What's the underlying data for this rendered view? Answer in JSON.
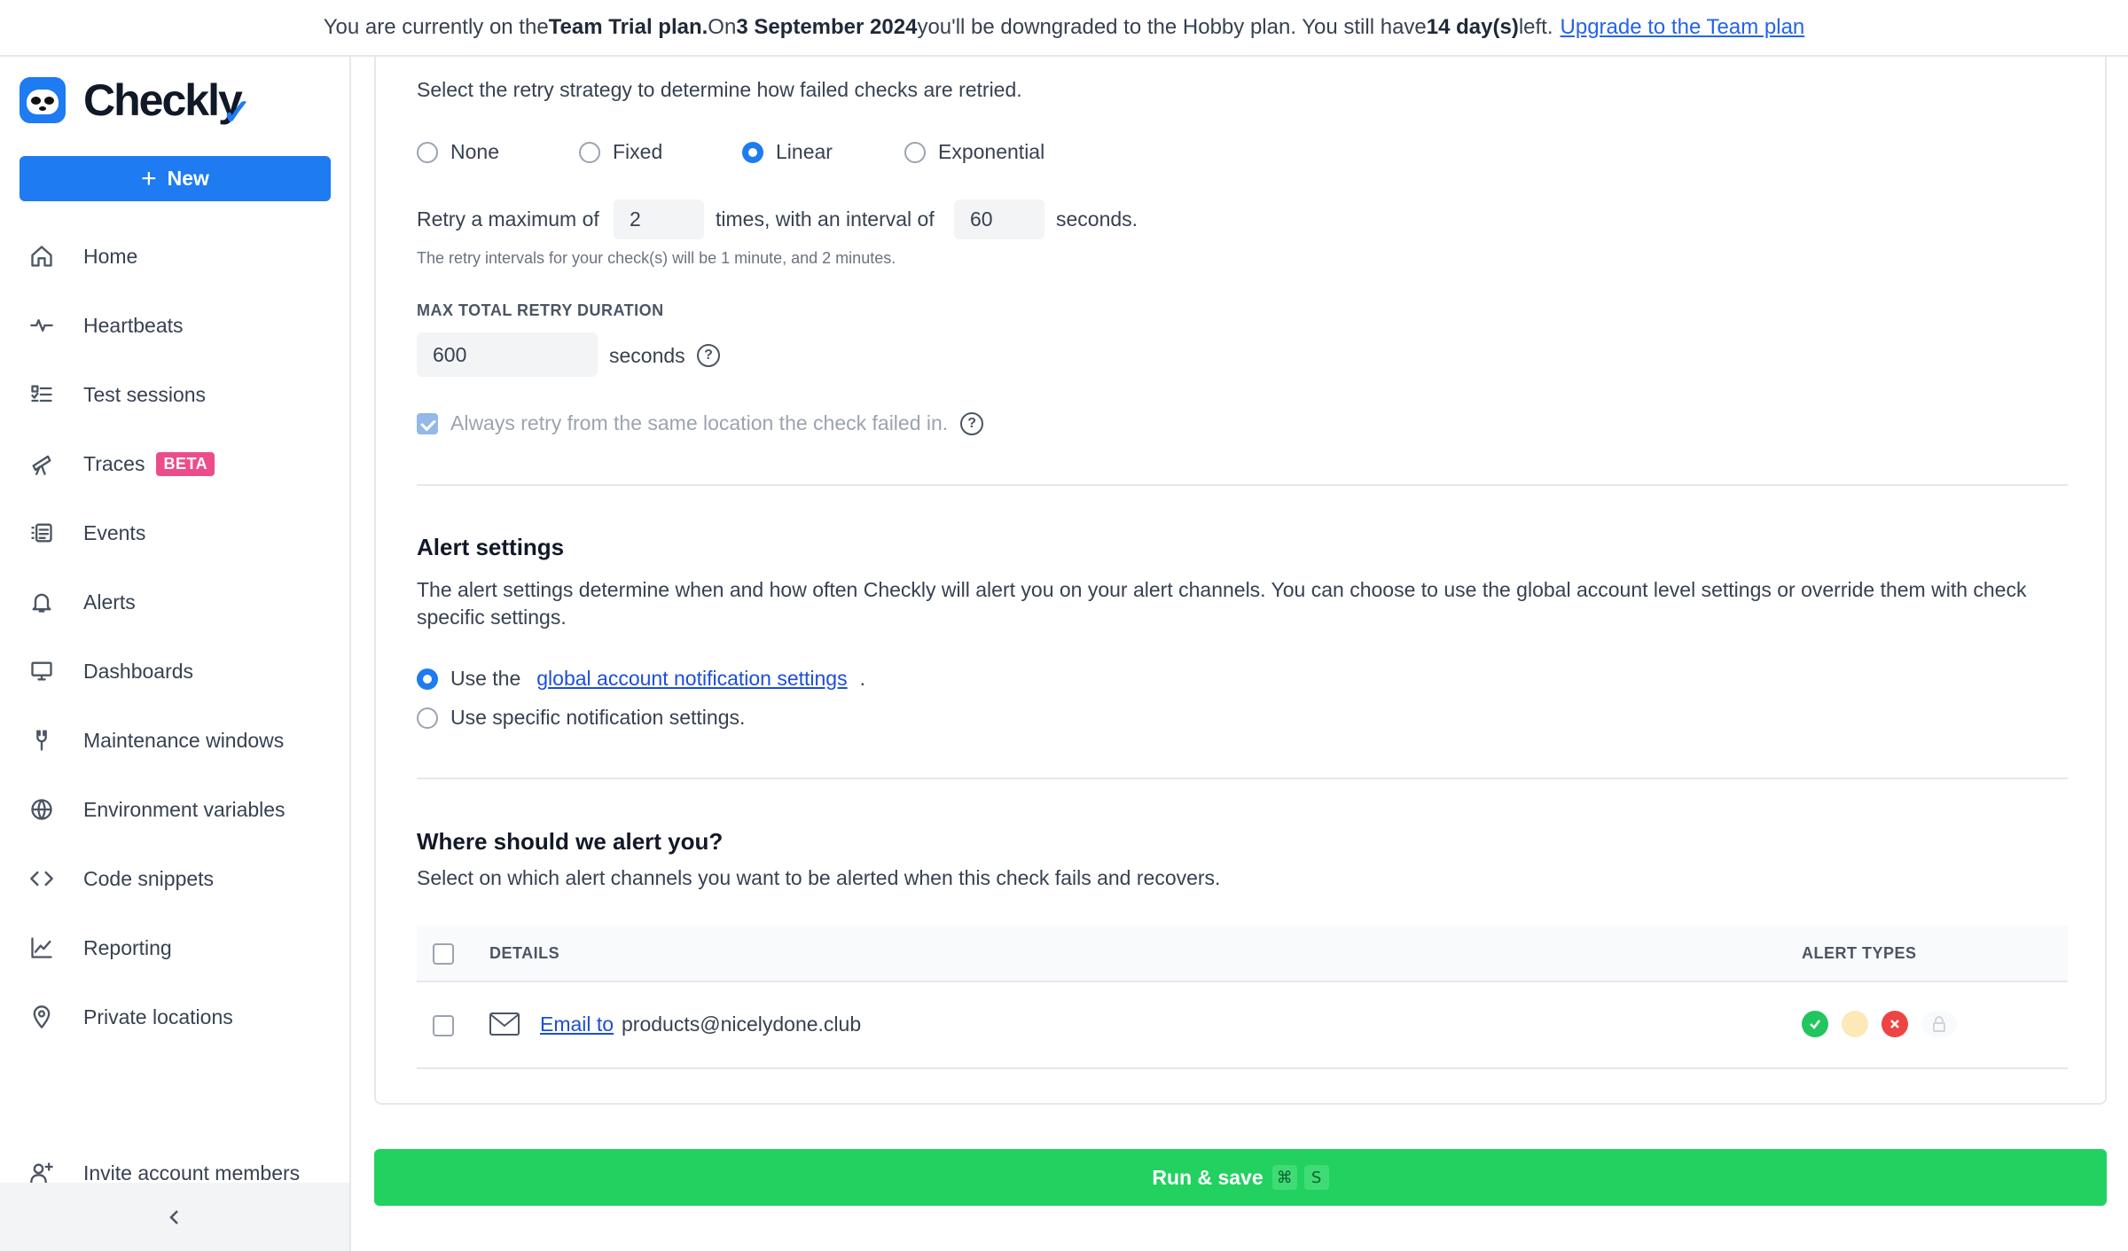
{
  "banner": {
    "t1": "You are currently on the ",
    "plan": "Team Trial plan.",
    "t2": " On ",
    "date": "3 September 2024",
    "t3": " you'll be downgraded to the Hobby plan. You still have ",
    "days": "14 day(s)",
    "t4": " left.",
    "upgrade_link": "Upgrade to the Team plan"
  },
  "sidebar": {
    "logo_text": "Checkly",
    "new_label": "New",
    "items": [
      {
        "label": "Home",
        "icon": "home-icon"
      },
      {
        "label": "Heartbeats",
        "icon": "heartbeat-icon"
      },
      {
        "label": "Test sessions",
        "icon": "test-sessions-icon"
      },
      {
        "label": "Traces",
        "icon": "telescope-icon",
        "badge": "BETA"
      },
      {
        "label": "Events",
        "icon": "events-icon"
      },
      {
        "label": "Alerts",
        "icon": "bell-icon"
      },
      {
        "label": "Dashboards",
        "icon": "monitor-icon"
      },
      {
        "label": "Maintenance windows",
        "icon": "wrench-icon"
      },
      {
        "label": "Environment variables",
        "icon": "globe-icon"
      },
      {
        "label": "Code snippets",
        "icon": "code-icon"
      },
      {
        "label": "Reporting",
        "icon": "chart-line-icon"
      },
      {
        "label": "Private locations",
        "icon": "map-pin-icon"
      }
    ],
    "invite_label": "Invite account members"
  },
  "retry": {
    "description": "Select the retry strategy to determine how failed checks are retried.",
    "options": [
      "None",
      "Fixed",
      "Linear",
      "Exponential"
    ],
    "selected": "Linear",
    "max_prefix": "Retry a maximum of",
    "max_value": "2",
    "interval_prefix": "times, with an interval of",
    "interval_value": "60",
    "interval_suffix": "seconds.",
    "hint": "The retry intervals for your check(s) will be 1 minute, and 2 minutes.",
    "duration_label": "MAX TOTAL RETRY DURATION",
    "duration_value": "600",
    "duration_unit": "seconds",
    "same_location_label": "Always retry from the same location the check failed in."
  },
  "alert_settings": {
    "title": "Alert settings",
    "description": "The alert settings determine when and how often Checkly will alert you on your alert channels. You can choose to use the global account level settings or override them with check specific settings.",
    "opt1_prefix": "Use the",
    "opt1_link": "global account notification settings",
    "opt1_suffix": ".",
    "opt2": "Use specific notification settings."
  },
  "where_alert": {
    "title": "Where should we alert you?",
    "description": "Select on which alert channels you want to be alerted when this check fails and recovers.",
    "col_details": "DETAILS",
    "col_alert_types": "ALERT TYPES",
    "rows": [
      {
        "link": "Email to",
        "address": "products@nicelydone.club",
        "icon": "mail-icon"
      }
    ]
  },
  "colors": {
    "accent": "#1e7bf2",
    "success": "#22c55e",
    "degraded": "#fde9b8",
    "failure": "#ef4444",
    "run_button": "#22d160",
    "beta_badge": "#ec4d8a"
  },
  "run_button": {
    "label": "Run & save",
    "key1": "⌘",
    "key2": "S"
  }
}
